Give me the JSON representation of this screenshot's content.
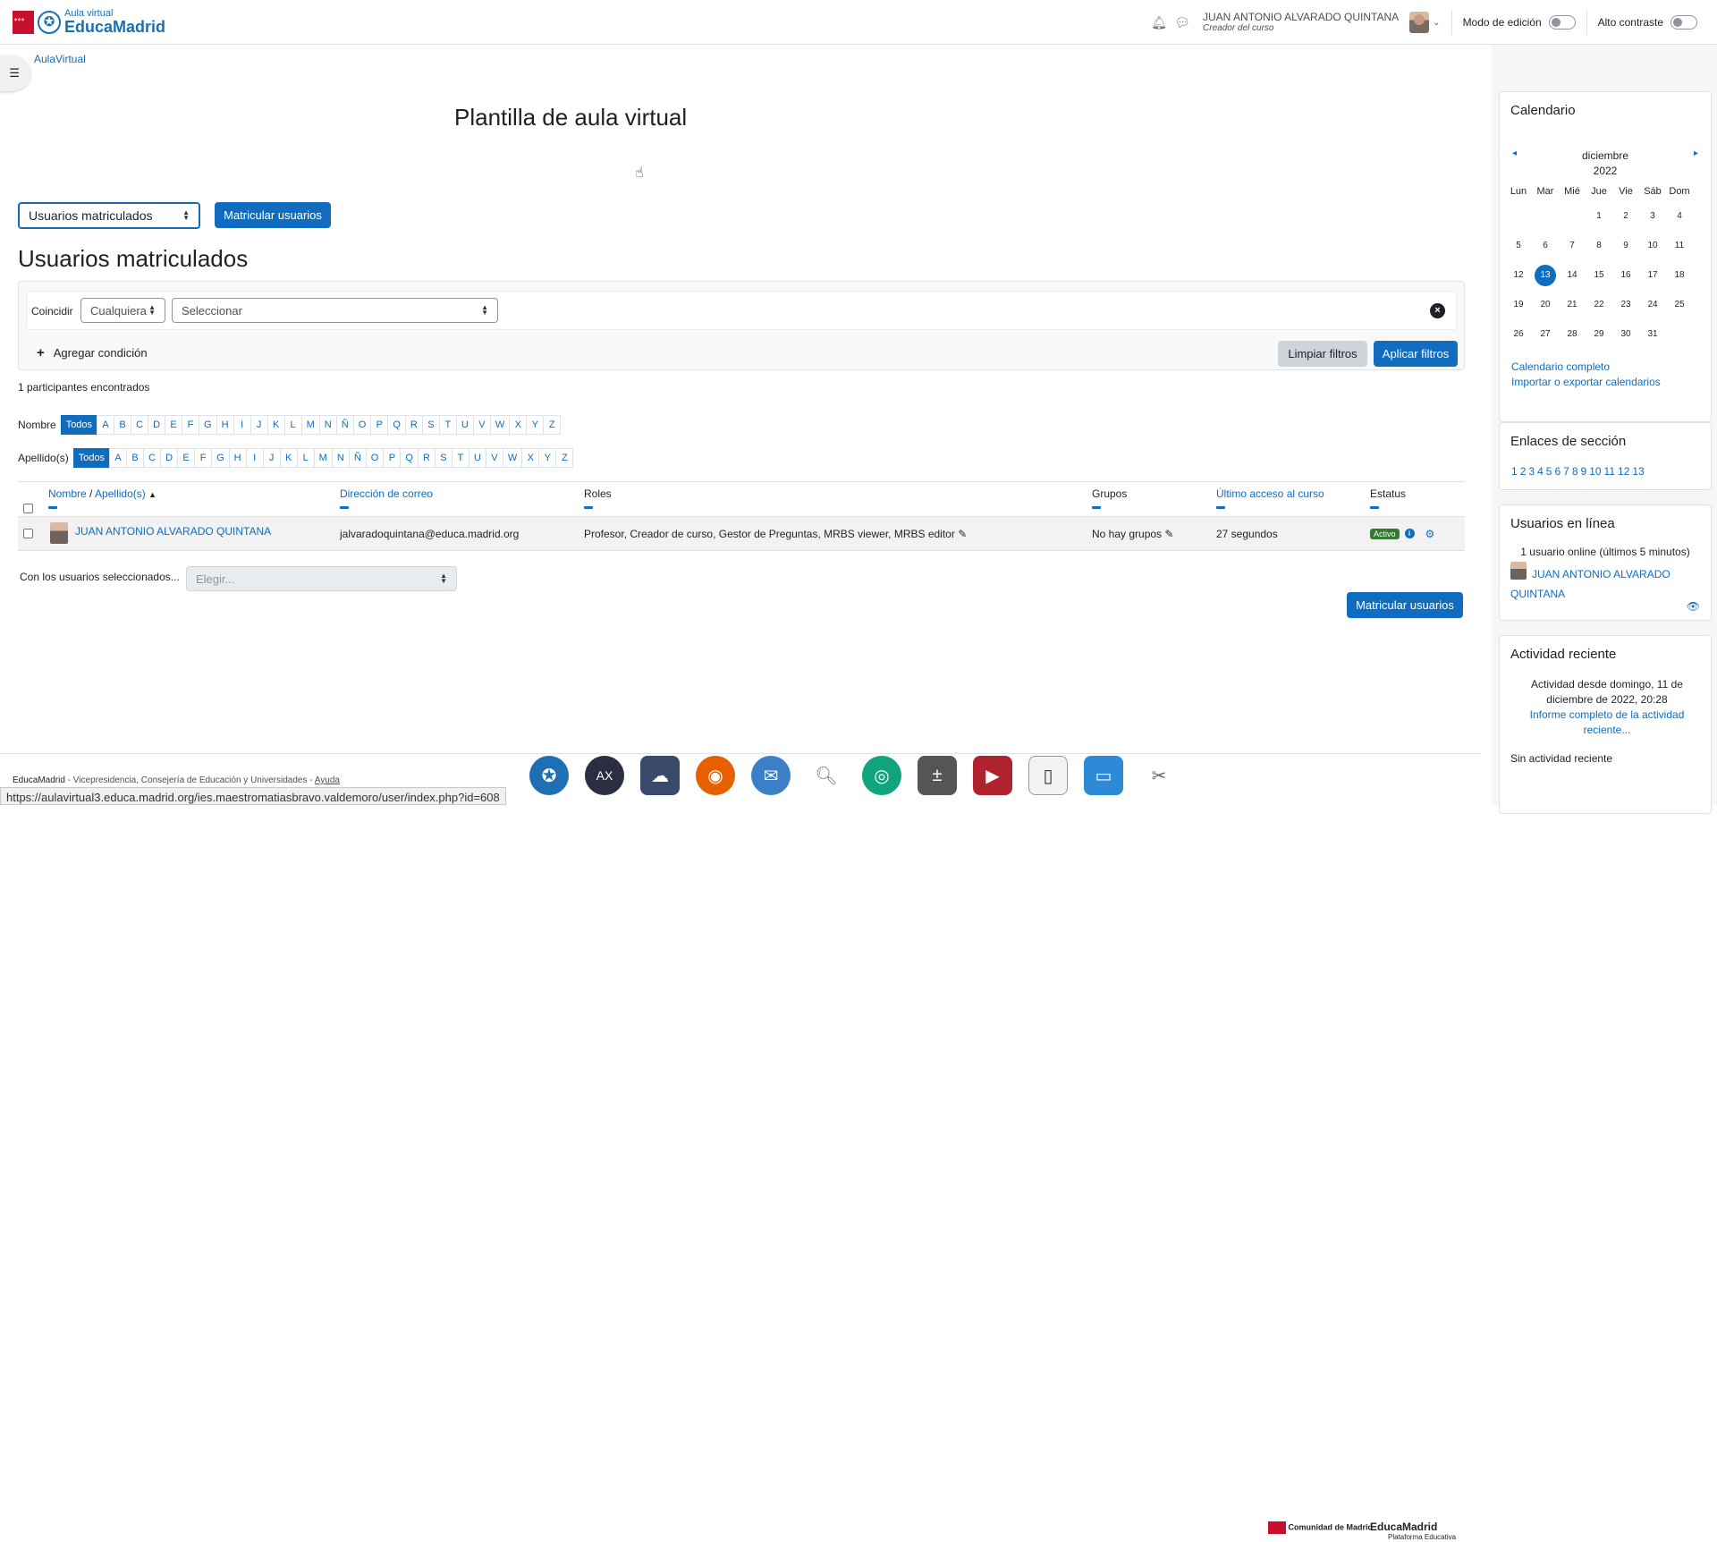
{
  "header": {
    "logo_small": "Aula virtual",
    "logo_big": "EducaMadrid",
    "user_name": "JUAN ANTONIO ALVARADO QUINTANA",
    "user_role": "Creador del curso",
    "edit_mode_label": "Modo de edición",
    "high_contrast_label": "Alto contraste"
  },
  "breadcrumb": {
    "item": "AulaVirtual"
  },
  "course": {
    "title": "Plantilla de aula virtual"
  },
  "toolbar": {
    "page_select": "Usuarios matriculados",
    "enrol_button": "Matricular usuarios"
  },
  "page": {
    "heading": "Usuarios matriculados"
  },
  "filters": {
    "match_label": "Coincidir",
    "match_value": "Cualquiera",
    "select_value": "Seleccionar",
    "add_condition": "Agregar condición",
    "clear_button": "Limpiar filtros",
    "apply_button": "Aplicar filtros"
  },
  "found_text": "1 participantes encontrados",
  "initials": {
    "firstname_label": "Nombre",
    "lastname_label": "Apellido(s)",
    "all_label": "Todos",
    "letters": [
      "A",
      "B",
      "C",
      "D",
      "E",
      "F",
      "G",
      "H",
      "I",
      "J",
      "K",
      "L",
      "M",
      "N",
      "Ñ",
      "O",
      "P",
      "Q",
      "R",
      "S",
      "T",
      "U",
      "V",
      "W",
      "X",
      "Y",
      "Z"
    ]
  },
  "table": {
    "headers": {
      "name": "Nombre",
      "sep": "/",
      "surname": "Apellido(s)",
      "email": "Dirección de correo",
      "roles": "Roles",
      "groups": "Grupos",
      "last_access": "Último acceso al curso",
      "status": "Estatus"
    },
    "row": {
      "name": "JUAN ANTONIO ALVARADO QUINTANA",
      "email": "jalvaradoquintana@educa.madrid.org",
      "roles": "Profesor, Creador de curso, Gestor de Preguntas, MRBS viewer, MRBS editor",
      "groups": "No hay grupos",
      "last_access": "27 segundos",
      "status": "Activo"
    }
  },
  "bulk": {
    "label": "Con los usuarios seleccionados...",
    "select_value": "Elegir..."
  },
  "bottom_enrol_button": "Matricular usuarios",
  "calendar": {
    "title": "Calendario",
    "month": "diciembre",
    "year": "2022",
    "days": [
      "Lun",
      "Mar",
      "Mié",
      "Jue",
      "Vie",
      "Sáb",
      "Dom"
    ],
    "weeks": [
      [
        "",
        "",
        "",
        "1",
        "2",
        "3",
        "4"
      ],
      [
        "5",
        "6",
        "7",
        "8",
        "9",
        "10",
        "11"
      ],
      [
        "12",
        "13",
        "14",
        "15",
        "16",
        "17",
        "18"
      ],
      [
        "19",
        "20",
        "21",
        "22",
        "23",
        "24",
        "25"
      ],
      [
        "26",
        "27",
        "28",
        "29",
        "30",
        "31",
        ""
      ]
    ],
    "today": "13",
    "full_link": "Calendario completo",
    "export_link": "Importar o exportar calendarios"
  },
  "section_links": {
    "title": "Enlaces de sección",
    "links": [
      "1",
      "2",
      "3",
      "4",
      "5",
      "6",
      "7",
      "8",
      "9",
      "10",
      "11",
      "12",
      "13"
    ]
  },
  "online_users": {
    "title": "Usuarios en línea",
    "summary": "1 usuario online (últimos 5 minutos)",
    "user": "JUAN ANTONIO ALVARADO QUINTANA"
  },
  "recent_activity": {
    "title": "Actividad reciente",
    "since": "Actividad desde domingo, 11 de diciembre de 2022, 20:28",
    "full_report": "Informe completo de la actividad reciente...",
    "none": "Sin actividad reciente"
  },
  "footer": {
    "brand": "EducaMadrid",
    "text": " - Vicepresidencia, Consejería de Educación y Universidades - ",
    "help": "Ayuda",
    "logo1": "Comunidad de Madrid",
    "logo2": "EducaMadrid",
    "logo2_sub": "Plataforma Educativa"
  },
  "status_url": "https://aulavirtual3.educa.madrid.org/ies.maestromatiasbravo.valdemoro/user/index.php?id=608"
}
